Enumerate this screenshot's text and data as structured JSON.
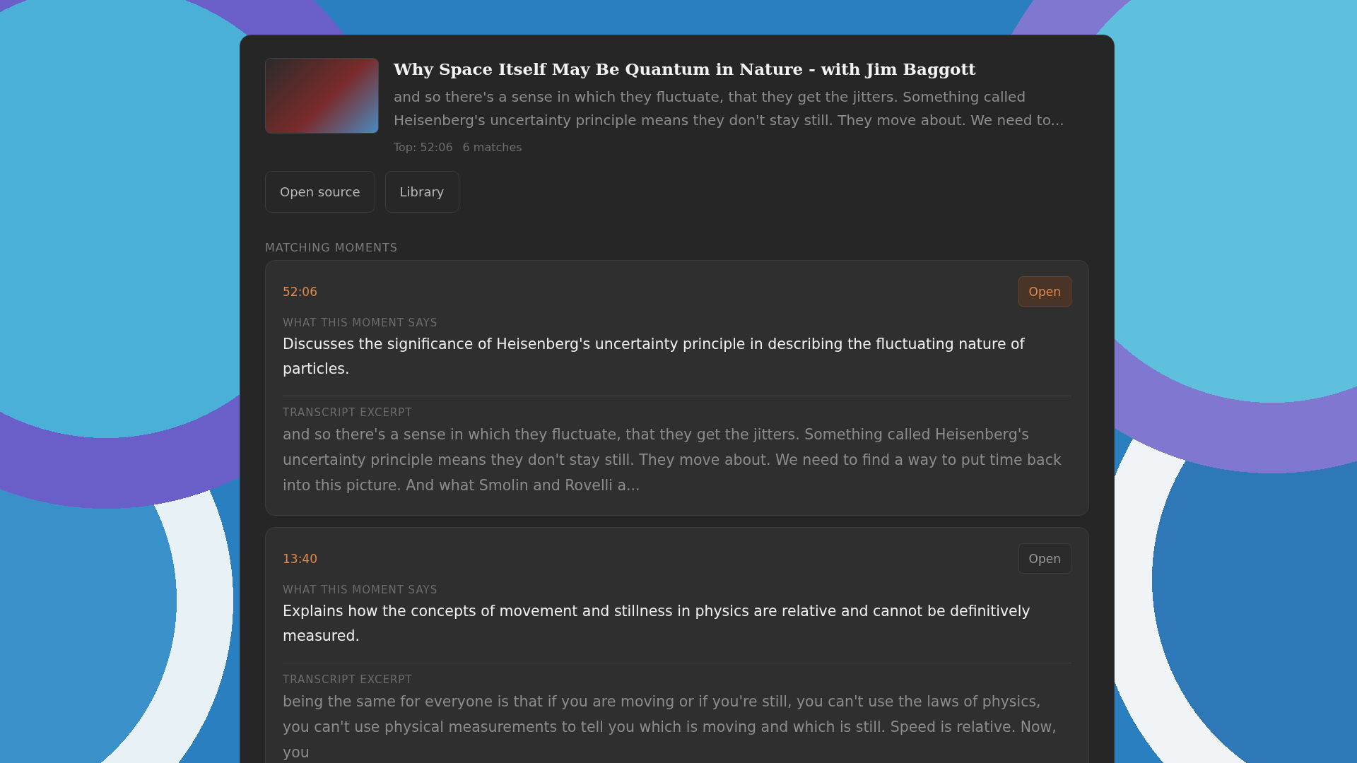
{
  "source": {
    "title": "Why Space Itself May Be Quantum in Nature - with Jim Baggott",
    "snippet": "and so there's a sense in which they fluctuate, that they get the jitters. Something called Heisenberg's uncertainty principle means they don't stay still. They move about. We need to...",
    "top": "Top: 52:06",
    "matches": "6 matches"
  },
  "actions": [
    "Open source",
    "Library"
  ],
  "section_title": "MATCHING MOMENTS",
  "moments": [
    {
      "time": "52:06",
      "open_label": "Open",
      "selected": true,
      "summary_label": "WHAT THIS MOMENT SAYS",
      "summary": "Discusses the significance of Heisenberg's uncertainty principle in describing the fluctuating nature of particles.",
      "excerpt_label": "TRANSCRIPT EXCERPT",
      "excerpt": "and so there's a sense in which they fluctuate, that they get the jitters. Something called Heisenberg's uncertainty principle means they don't stay still. They move about. We need to find a way to put time back into this picture. And what Smolin and Rovelli a..."
    },
    {
      "time": "13:40",
      "open_label": "Open",
      "selected": false,
      "summary_label": "WHAT THIS MOMENT SAYS",
      "summary": "Explains how the concepts of movement and stillness in physics are relative and cannot be definitively measured.",
      "excerpt_label": "TRANSCRIPT EXCERPT",
      "excerpt": "being the same for everyone is that if you are moving or if you're still, you can't use the laws of physics, you can't use physical measurements to tell you which is moving and which is still. Speed is relative. Now, you"
    }
  ]
}
